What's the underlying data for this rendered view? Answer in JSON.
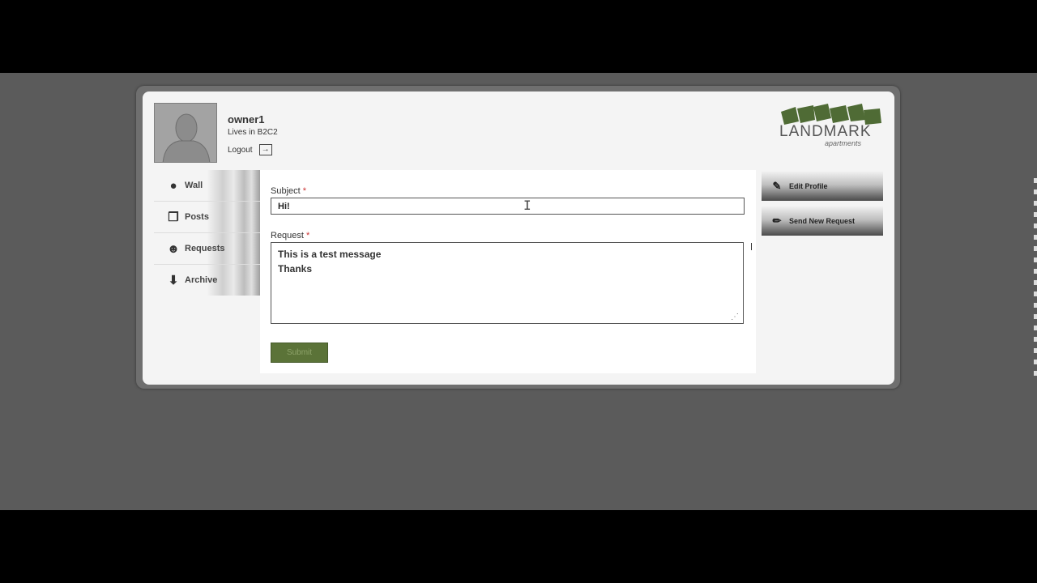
{
  "profile": {
    "username": "owner1",
    "lives_in": "Lives in B2C2",
    "logout_label": "Logout"
  },
  "logo": {
    "name": "LANDMARK",
    "tagline": "apartments",
    "brand_color": "#4f6b35"
  },
  "nav": {
    "items": [
      {
        "label": "Wall",
        "icon": "chat-bubble-icon"
      },
      {
        "label": "Posts",
        "icon": "documents-icon"
      },
      {
        "label": "Requests",
        "icon": "user-icon"
      },
      {
        "label": "Archive",
        "icon": "download-icon"
      }
    ]
  },
  "form": {
    "subject_label": "Subject",
    "subject_value": "Hi!",
    "request_label": "Request",
    "request_value": "This is a test message\nThanks",
    "required_mark": "*",
    "submit_label": "Submit"
  },
  "side_actions": {
    "edit_profile": "Edit Profile",
    "send_request": "Send New Request"
  },
  "colors": {
    "page_bg": "#5b5b5b",
    "submit_green": "#5b7338"
  }
}
